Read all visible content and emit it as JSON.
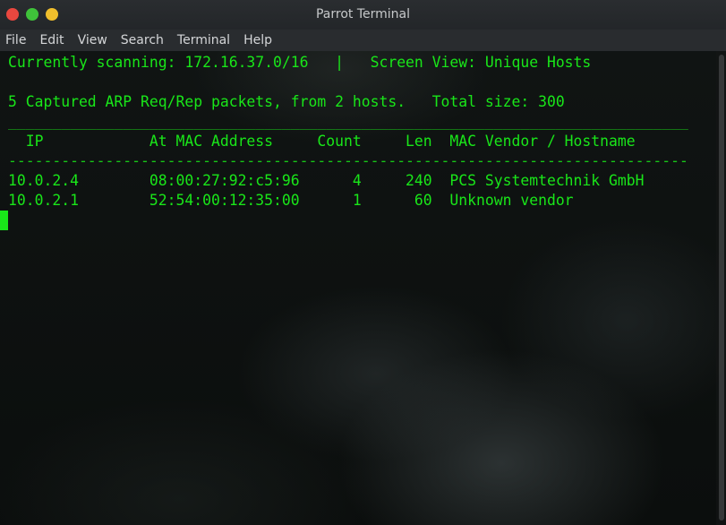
{
  "window": {
    "title": "Parrot Terminal",
    "colors": {
      "close": "#e9473f",
      "maximize": "#3fc23a",
      "minimize": "#f0be2c",
      "terminal_text": "#19e619"
    }
  },
  "menubar": {
    "items": [
      "File",
      "Edit",
      "View",
      "Search",
      "Terminal",
      "Help"
    ]
  },
  "terminal": {
    "status_line": "Currently scanning: 172.16.37.0/16   |   Screen View: Unique Hosts",
    "summary_line": "5 Captured ARP Req/Rep packets, from 2 hosts.   Total size: 300",
    "top_rule": "_____________________________________________________________________________",
    "header_line": "  IP            At MAC Address     Count     Len  MAC Vendor / Hostname",
    "header_rule": "-----------------------------------------------------------------------------",
    "rows": [
      "10.0.2.4        08:00:27:92:c5:96      4     240  PCS Systemtechnik GmbH",
      "10.0.2.1        52:54:00:12:35:00      1      60  Unknown vendor"
    ],
    "hosts": [
      {
        "ip": "10.0.2.4",
        "mac": "08:00:27:92:c5:96",
        "count": 4,
        "len": 240,
        "vendor": "PCS Systemtechnik GmbH"
      },
      {
        "ip": "10.0.2.1",
        "mac": "52:54:00:12:35:00",
        "count": 1,
        "len": 60,
        "vendor": "Unknown vendor"
      }
    ]
  }
}
